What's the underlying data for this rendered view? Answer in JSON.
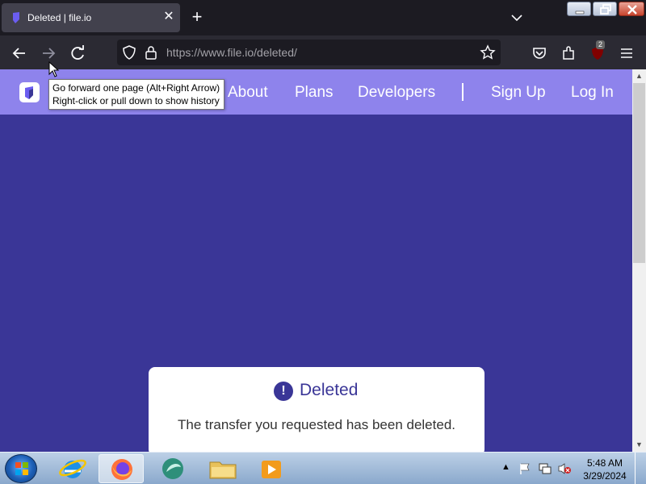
{
  "browser": {
    "tab_title": "Deleted | file.io",
    "new_tab": "+",
    "url_host": "https://www.file.io",
    "url_path": "/deleted/",
    "extension_badge": "2"
  },
  "tooltip": {
    "line1": "Go forward one page (Alt+Right Arrow)",
    "line2": "Right-click or pull down to show history"
  },
  "site_nav": {
    "items": [
      "About",
      "Plans",
      "Developers",
      "Sign Up",
      "Log In"
    ]
  },
  "card": {
    "icon": "!",
    "title": "Deleted",
    "message": "The transfer you requested has been deleted."
  },
  "taskbar": {
    "time": "5:48 AM",
    "date": "3/29/2024"
  },
  "colors": {
    "page_bg": "#3a3697",
    "site_nav_bg": "#8e83ec",
    "card_bg": "#ffffff"
  }
}
